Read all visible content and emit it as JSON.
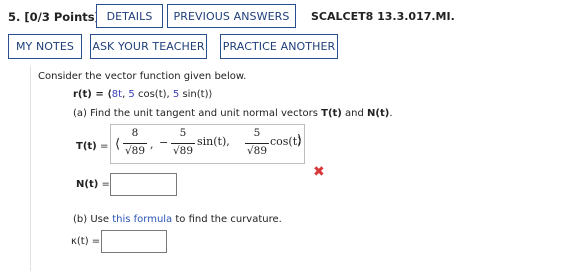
{
  "header": {
    "question_number": "5.",
    "points": "[0/3 Points]",
    "details_label": "DETAILS",
    "previous_answers_label": "PREVIOUS ANSWERS",
    "question_id": "SCALCET8 13.3.017.MI."
  },
  "toolbar": {
    "my_notes_label": "MY NOTES",
    "ask_teacher_label": "ASK YOUR TEACHER",
    "practice_another_label": "PRACTICE ANOTHER"
  },
  "problem": {
    "intro": "Consider the vector function given below.",
    "r_prefix": "r(t) = ⟨",
    "r_c1": "8t",
    "r_sep1": ", ",
    "r_c2_coef": "5",
    "r_c2_fn": " cos(t)",
    "r_sep2": ", ",
    "r_c3_coef": "5",
    "r_c3_fn": " sin(t)",
    "r_suffix": "⟩",
    "part_a_prefix": "(a) Find the unit tangent and unit normal vectors ",
    "part_a_T": "T(t)",
    "part_a_and": " and ",
    "part_a_N": "N(t)",
    "part_a_end": ".",
    "T_label": "T(t)",
    "equals": "=",
    "T_answer": {
      "lbracket": "⟨",
      "num1": "8",
      "den1": "√89",
      "sep1": ",",
      "minus": "−",
      "num2": "5",
      "den2": "√89",
      "fn2": "sin(t),",
      "num3": "5",
      "den3": "√89",
      "fn3": "cos(t)",
      "rbracket": "⟩"
    },
    "T_status": "✖",
    "N_label": "N(t)",
    "N_value": "",
    "part_b_prefix": "(b) Use ",
    "part_b_link": "this formula",
    "part_b_suffix": " to find the curvature.",
    "kappa_label": "κ(t) =",
    "kappa_value": ""
  },
  "colors": {
    "button_border": "#2a4f8f",
    "button_text": "#1f3f7a",
    "coefficient_blue": "#3a3fb5",
    "error_red": "#d9383a",
    "link_blue": "#2a56b8"
  }
}
